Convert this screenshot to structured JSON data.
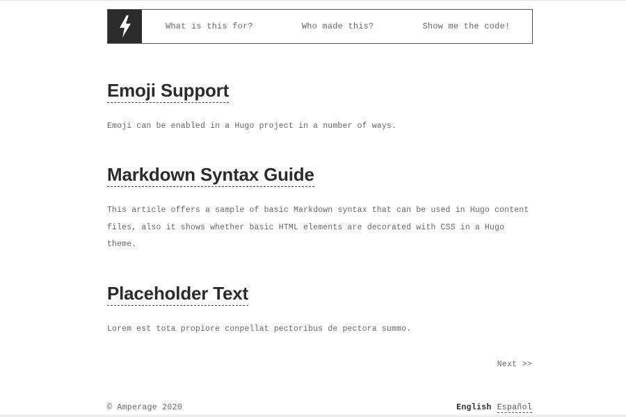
{
  "nav": {
    "logo_icon": "lightning-bolt-icon",
    "links": [
      {
        "label": "What is this for?"
      },
      {
        "label": "Who made this?"
      },
      {
        "label": "Show me the code!"
      }
    ]
  },
  "posts": [
    {
      "title": "Emoji Support",
      "summary": "Emoji can be enabled in a Hugo project in a number of ways."
    },
    {
      "title": "Markdown Syntax Guide",
      "summary": "This article offers a sample of basic Markdown syntax that can be used in Hugo content files, also it shows whether basic HTML elements are decorated with CSS in a Hugo theme."
    },
    {
      "title": "Placeholder Text",
      "summary": "Lorem est tota propiore conpellat pectoribus de pectora summo."
    }
  ],
  "pagination": {
    "next_label": "Next >>"
  },
  "footer": {
    "copyright": "© Amperage 2020",
    "languages": {
      "current": "English",
      "other": "Español"
    }
  },
  "colors": {
    "logo_bg": "#2b2b2b",
    "text": "#666666",
    "heading": "#2b2b2b"
  }
}
